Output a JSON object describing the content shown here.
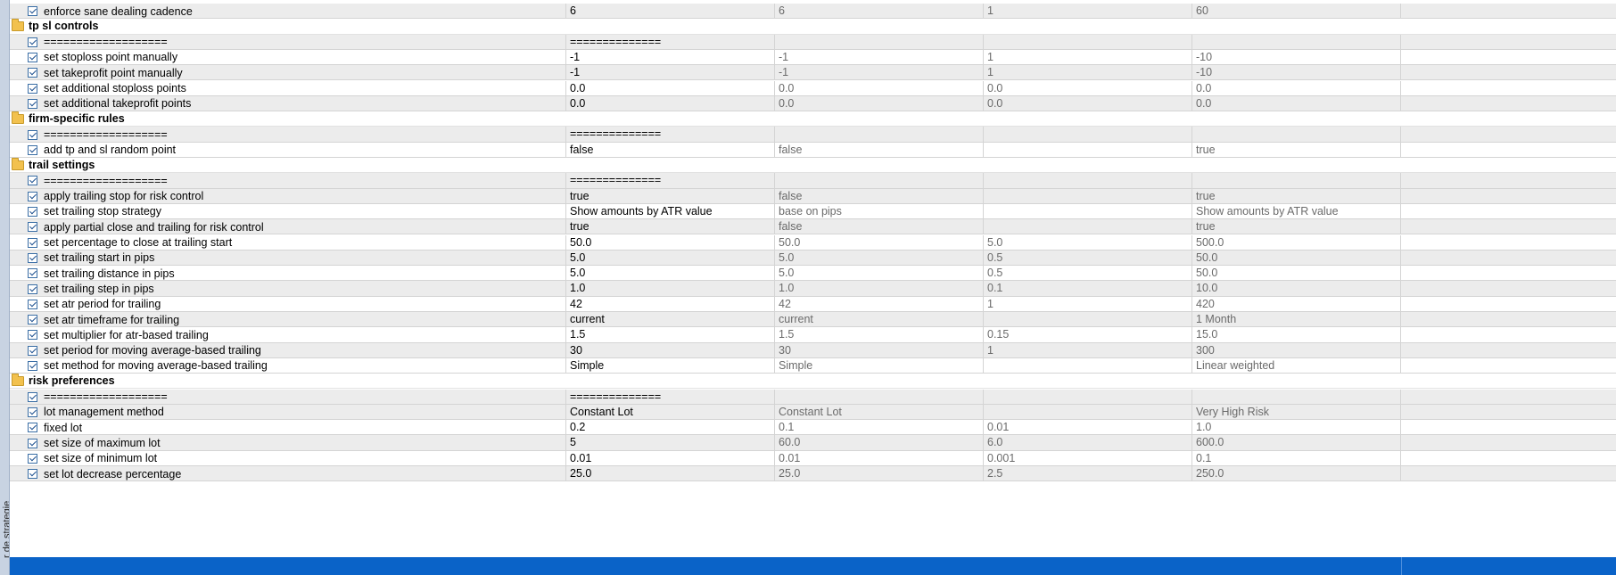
{
  "side_panel": {
    "label": "r de strategie"
  },
  "rows": [
    {
      "type": "param",
      "name": "enforce sane dealing cadence",
      "value": "6",
      "start": "6",
      "step": "1",
      "stop": "60"
    },
    {
      "type": "group",
      "name": "tp sl controls"
    },
    {
      "type": "param",
      "name": "===================",
      "value": "==============",
      "start": "",
      "step": "",
      "stop": "",
      "separator": true
    },
    {
      "type": "param",
      "name": "set stoploss point manually",
      "value": "-1",
      "start": "-1",
      "step": "1",
      "stop": "-10"
    },
    {
      "type": "param",
      "name": "set takeprofit point manually",
      "value": "-1",
      "start": "-1",
      "step": "1",
      "stop": "-10"
    },
    {
      "type": "param",
      "name": "set additional stoploss points",
      "value": "0.0",
      "start": "0.0",
      "step": "0.0",
      "stop": "0.0"
    },
    {
      "type": "param",
      "name": "set additional takeprofit points",
      "value": "0.0",
      "start": "0.0",
      "step": "0.0",
      "stop": "0.0"
    },
    {
      "type": "group",
      "name": "firm-specific rules"
    },
    {
      "type": "param",
      "name": "===================",
      "value": "==============",
      "start": "",
      "step": "",
      "stop": "",
      "separator": true
    },
    {
      "type": "param",
      "name": "add tp and sl random point",
      "value": "false",
      "start": "false",
      "step": "",
      "stop": "true"
    },
    {
      "type": "group",
      "name": "trail settings"
    },
    {
      "type": "param",
      "name": "===================",
      "value": "==============",
      "start": "",
      "step": "",
      "stop": "",
      "separator": true
    },
    {
      "type": "param",
      "name": "apply trailing stop for risk control",
      "value": "true",
      "start": "false",
      "step": "",
      "stop": "true"
    },
    {
      "type": "param",
      "name": "set trailing stop strategy",
      "value": "Show amounts by ATR value",
      "start": "base on pips",
      "step": "",
      "stop": "Show amounts by ATR value"
    },
    {
      "type": "param",
      "name": "apply partial close and trailing for risk control",
      "value": "true",
      "start": "false",
      "step": "",
      "stop": "true"
    },
    {
      "type": "param",
      "name": "set percentage to close at trailing start",
      "value": "50.0",
      "start": "50.0",
      "step": "5.0",
      "stop": "500.0"
    },
    {
      "type": "param",
      "name": "set trailing start in pips",
      "value": "5.0",
      "start": "5.0",
      "step": "0.5",
      "stop": "50.0"
    },
    {
      "type": "param",
      "name": "set trailing distance in pips",
      "value": "5.0",
      "start": "5.0",
      "step": "0.5",
      "stop": "50.0"
    },
    {
      "type": "param",
      "name": "set trailing step in pips",
      "value": "1.0",
      "start": "1.0",
      "step": "0.1",
      "stop": "10.0"
    },
    {
      "type": "param",
      "name": "set atr period for trailing",
      "value": "42",
      "start": "42",
      "step": "1",
      "stop": "420"
    },
    {
      "type": "param",
      "name": "set atr timeframe for trailing",
      "value": "current",
      "start": "current",
      "step": "",
      "stop": "1 Month"
    },
    {
      "type": "param",
      "name": "set multiplier for atr-based trailing",
      "value": "1.5",
      "start": "1.5",
      "step": "0.15",
      "stop": "15.0"
    },
    {
      "type": "param",
      "name": "set period for moving average-based trailing",
      "value": "30",
      "start": "30",
      "step": "1",
      "stop": "300"
    },
    {
      "type": "param",
      "name": "set method for moving average-based trailing",
      "value": "Simple",
      "start": "Simple",
      "step": "",
      "stop": "Linear weighted"
    },
    {
      "type": "group",
      "name": "risk preferences"
    },
    {
      "type": "param",
      "name": "===================",
      "value": "==============",
      "start": "",
      "step": "",
      "stop": "",
      "separator": true
    },
    {
      "type": "param",
      "name": "lot management method",
      "value": "Constant Lot",
      "start": "Constant Lot",
      "step": "",
      "stop": "Very High Risk"
    },
    {
      "type": "param",
      "name": "fixed lot",
      "value": "0.2",
      "start": "0.1",
      "step": "0.01",
      "stop": "1.0"
    },
    {
      "type": "param",
      "name": "set size of maximum lot",
      "value": "5",
      "start": "60.0",
      "step": "6.0",
      "stop": "600.0"
    },
    {
      "type": "param",
      "name": "set size of minimum lot",
      "value": "0.01",
      "start": "0.01",
      "step": "0.001",
      "stop": "0.1"
    },
    {
      "type": "param",
      "name": "set lot decrease percentage",
      "value": "25.0",
      "start": "25.0",
      "step": "2.5",
      "stop": "250.0"
    }
  ],
  "colors": {
    "selection": "#0a63c8",
    "folder": "#f2c14e",
    "row_alt": "#ececec"
  }
}
